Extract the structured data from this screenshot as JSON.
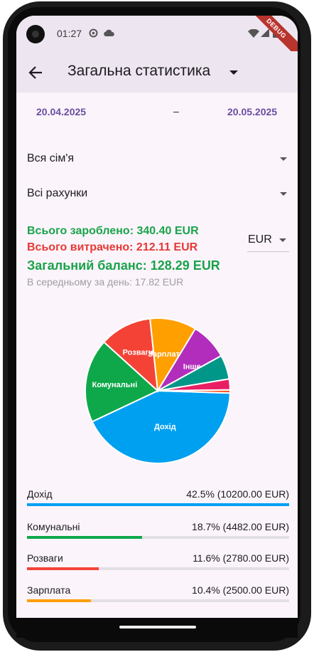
{
  "status": {
    "time": "01:27",
    "debug_label": "DEBUG"
  },
  "header": {
    "title": "Загальна статистика"
  },
  "dates": {
    "from": "20.04.2025",
    "separator": "–",
    "to": "20.05.2025"
  },
  "filters": {
    "family": "Вся сім'я",
    "accounts": "Всі рахунки"
  },
  "summary": {
    "earned": "Всього зароблено: 340.40 EUR",
    "spent": "Всього витрачено: 212.11 EUR",
    "balance": "Загальний баланс: 128.29 EUR",
    "daily_average": "В середньому за день: 17.82 EUR"
  },
  "currency": {
    "selected": "EUR"
  },
  "chart_data": {
    "type": "pie",
    "slices": [
      {
        "label": "Дохід",
        "value": 42.5,
        "color": "#00a0f0"
      },
      {
        "label": "Комунальні",
        "value": 18.7,
        "color": "#0ea84a"
      },
      {
        "label": "Розваги",
        "value": 11.6,
        "color": "#f44336"
      },
      {
        "label": "Зарплата",
        "value": 10.4,
        "color": "#ff9f00"
      },
      {
        "label": "Інше",
        "value": 8.3,
        "color": "#b22dbb"
      },
      {
        "label": "",
        "value": 5.4,
        "color": "#009688"
      },
      {
        "label": "",
        "value": 2.4,
        "color": "#e91e63"
      },
      {
        "label": "",
        "value": 0.7,
        "color": "#ff5722"
      }
    ]
  },
  "legend": [
    {
      "name": "Дохід",
      "value_text": "42.5% (10200.00 EUR)",
      "percent": 42.5,
      "color": "#00a0f0"
    },
    {
      "name": "Комунальні",
      "value_text": "18.7% (4482.00 EUR)",
      "percent": 18.7,
      "color": "#0ea84a"
    },
    {
      "name": "Розваги",
      "value_text": "11.6% (2780.00 EUR)",
      "percent": 11.6,
      "color": "#f44336"
    },
    {
      "name": "Зарплата",
      "value_text": "10.4% (2500.00 EUR)",
      "percent": 10.4,
      "color": "#ff9f00"
    }
  ]
}
